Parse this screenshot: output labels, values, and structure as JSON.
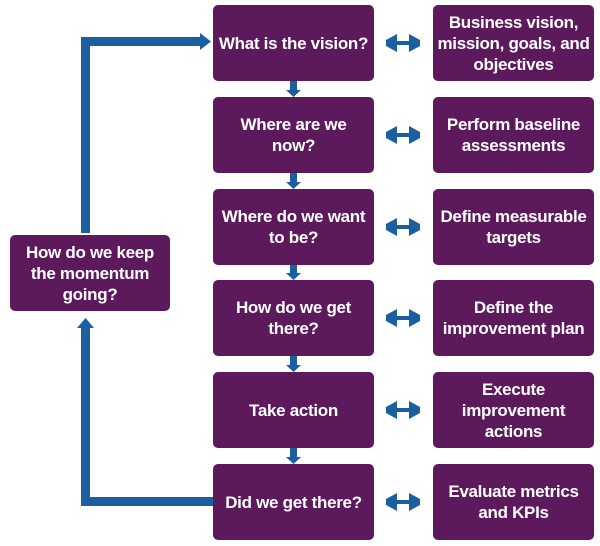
{
  "colors": {
    "box": "#5c1a5c",
    "arrow": "#1b5fa0",
    "text": "#ffffff"
  },
  "steps": [
    {
      "question": "What is the vision?",
      "action": "Business vision, mission, goals, and objectives"
    },
    {
      "question": "Where are we now?",
      "action": "Perform baseline assessments"
    },
    {
      "question": "Where do we want to be?",
      "action": "Define measurable targets"
    },
    {
      "question": "How do we get there?",
      "action": "Define the improvement plan"
    },
    {
      "question": "Take action",
      "action": "Execute improvement actions"
    },
    {
      "question": "Did we get there?",
      "action": "Evaluate metrics and KPIs"
    }
  ],
  "loop": {
    "label": "How do we keep the momentum going?"
  }
}
